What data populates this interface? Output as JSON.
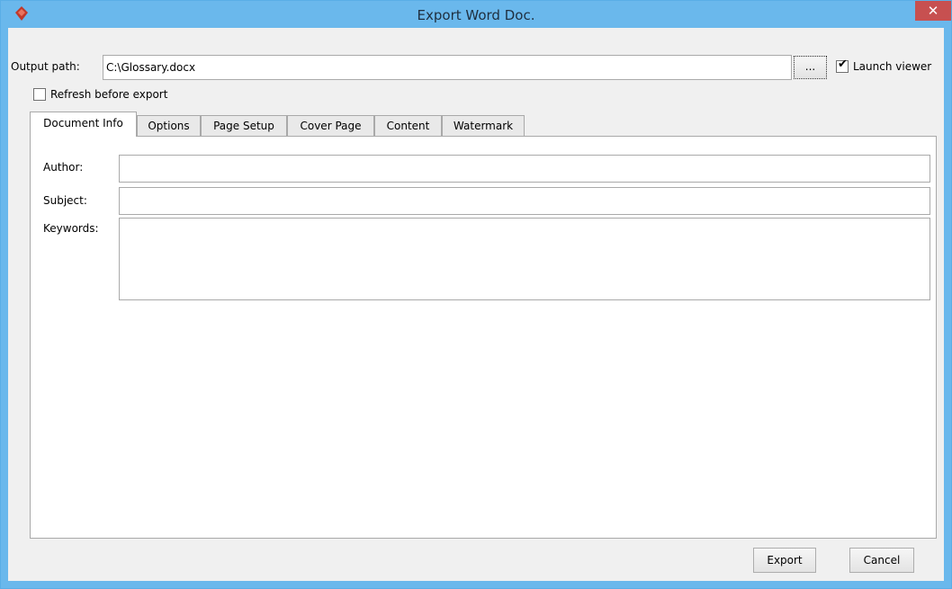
{
  "window": {
    "title": "Export Word Doc.",
    "close_glyph": "✕",
    "app_icon": "visual-paradigm-diamond-icon"
  },
  "output_path": {
    "label": "Output path:",
    "value": "C:\\Glossary.docx",
    "browse_label": "..."
  },
  "launch_viewer": {
    "label": "Launch viewer",
    "checked": true
  },
  "refresh_before_export": {
    "label": "Refresh before export",
    "checked": false
  },
  "tabs": [
    {
      "label": "Document Info",
      "active": true
    },
    {
      "label": "Options",
      "active": false
    },
    {
      "label": "Page Setup",
      "active": false
    },
    {
      "label": "Cover Page",
      "active": false
    },
    {
      "label": "Content",
      "active": false
    },
    {
      "label": "Watermark",
      "active": false
    }
  ],
  "document_info": {
    "author_label": "Author:",
    "author_value": "",
    "subject_label": "Subject:",
    "subject_value": "",
    "keywords_label": "Keywords:",
    "keywords_value": ""
  },
  "footer": {
    "export_label": "Export",
    "cancel_label": "Cancel"
  },
  "colors": {
    "titlebar": "#6ab8ec",
    "close": "#c75050",
    "accent": "#c0392b"
  }
}
